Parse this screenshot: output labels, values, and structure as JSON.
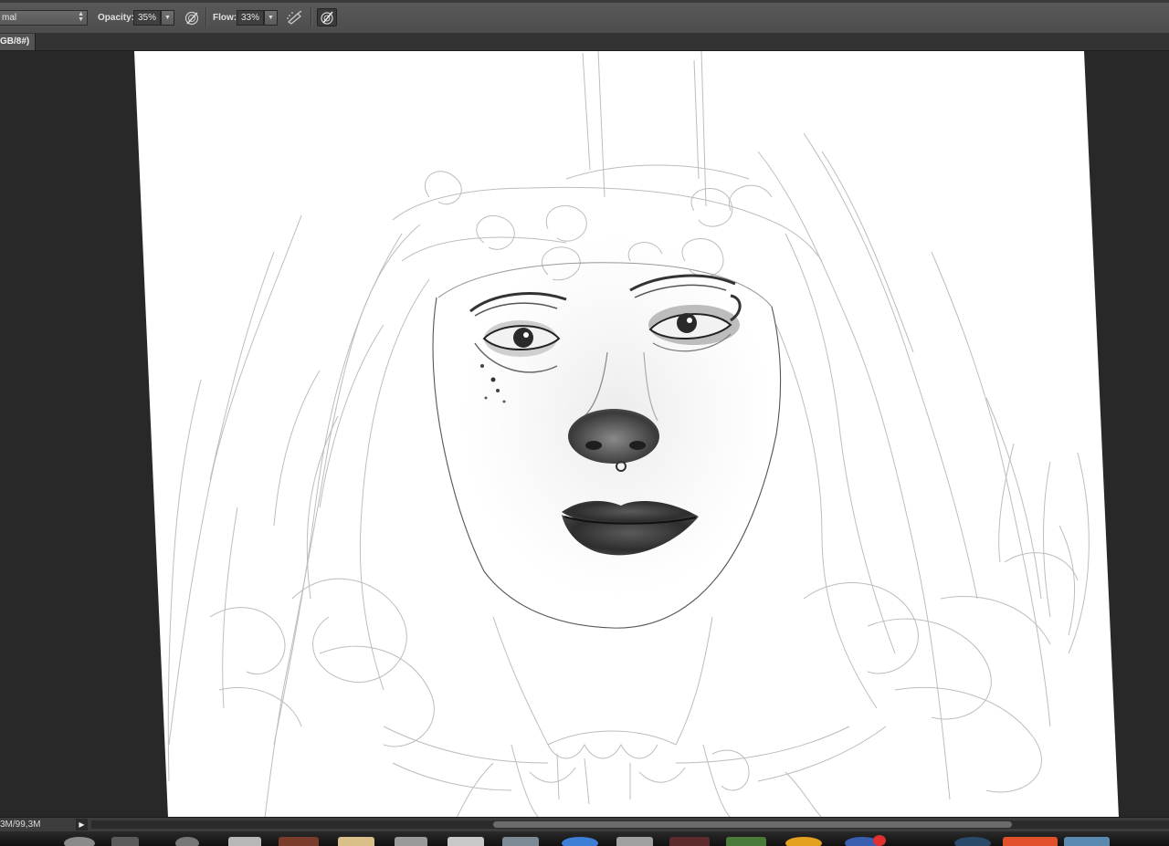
{
  "options_bar": {
    "blend_mode": "mal",
    "opacity_label": "Opacity:",
    "opacity_value": "35%",
    "flow_label": "Flow:",
    "flow_value": "33%"
  },
  "document_tab": {
    "label": "GB/8#)"
  },
  "status_bar": {
    "doc_size": "3M/99,3M"
  },
  "icons": {
    "blend_arrows": "up-down-arrows-icon",
    "dropdown": "chevron-down-icon",
    "pressure_opacity": "pressure-opacity-icon",
    "airbrush": "airbrush-icon",
    "pressure_size": "pressure-size-icon",
    "status_menu": "play-arrow-icon"
  }
}
